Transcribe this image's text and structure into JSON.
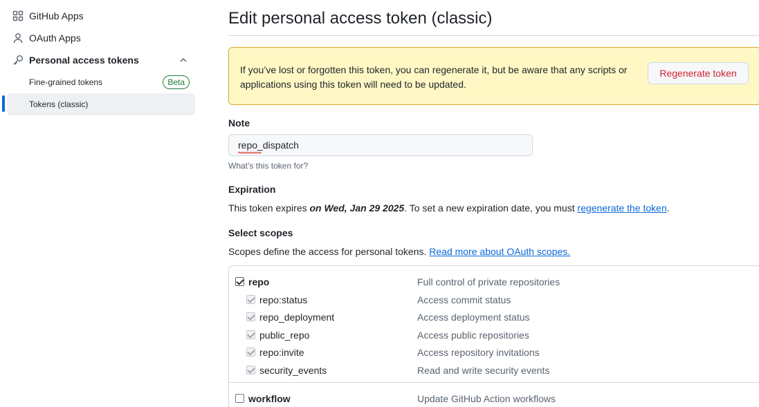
{
  "sidebar": {
    "items": [
      {
        "label": "GitHub Apps",
        "icon": "apps-icon"
      },
      {
        "label": "OAuth Apps",
        "icon": "person-icon"
      },
      {
        "label": "Personal access tokens",
        "icon": "key-icon",
        "expanded": true
      }
    ],
    "sub_items": [
      {
        "label": "Fine-grained tokens",
        "badge": "Beta"
      },
      {
        "label": "Tokens (classic)",
        "active": true
      }
    ]
  },
  "main": {
    "title": "Edit personal access token (classic)",
    "flash": {
      "text": "If you’ve lost or forgotten this token, you can regenerate it, but be aware that any scripts or applications using this token will need to be updated.",
      "button": "Regenerate token"
    },
    "note": {
      "label": "Note",
      "value": "repo_dispatch",
      "hint": "What’s this token for?"
    },
    "expiration": {
      "label": "Expiration",
      "prefix": "This token expires ",
      "date": "on Wed, Jan 29 2025",
      "middle": ". To set a new expiration date, you must ",
      "link": "regenerate the token",
      "suffix": "."
    },
    "scopes": {
      "label": "Select scopes",
      "desc_prefix": "Scopes define the access for personal tokens. ",
      "desc_link": "Read more about OAuth scopes.",
      "rows": [
        {
          "name": "repo",
          "desc": "Full control of private repositories",
          "parent": true,
          "checked": true
        },
        {
          "name": "repo:status",
          "desc": "Access commit status",
          "parent": false,
          "checked": true
        },
        {
          "name": "repo_deployment",
          "desc": "Access deployment status",
          "parent": false,
          "checked": true
        },
        {
          "name": "public_repo",
          "desc": "Access public repositories",
          "parent": false,
          "checked": true
        },
        {
          "name": "repo:invite",
          "desc": "Access repository invitations",
          "parent": false,
          "checked": true
        },
        {
          "name": "security_events",
          "desc": "Read and write security events",
          "parent": false,
          "checked": true
        },
        {
          "name": "workflow",
          "desc": "Update GitHub Action workflows",
          "parent": true,
          "checked": false
        }
      ]
    }
  },
  "colors": {
    "accent": "#0969da",
    "danger": "#cf222e",
    "success": "#1a7f37",
    "flash_bg": "#fff8c5",
    "flash_border": "#d4a72c"
  }
}
